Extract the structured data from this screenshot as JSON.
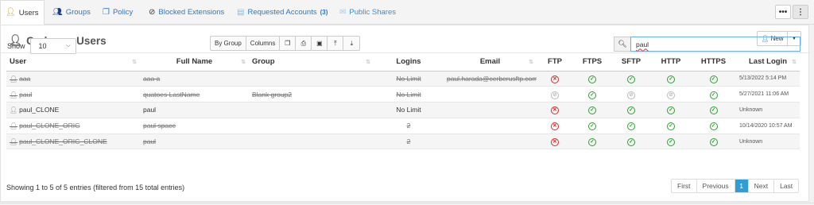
{
  "tabs": [
    {
      "label": "Users",
      "icon": "user-icon"
    },
    {
      "label": "Groups",
      "icon": "group-icon"
    },
    {
      "label": "Policy",
      "icon": "policy-icon"
    },
    {
      "label": "Blocked Extensions",
      "icon": "ban-icon"
    },
    {
      "label": "Requested  Accounts",
      "count": "(3)",
      "icon": "inbox-icon"
    },
    {
      "label": "Public Shares",
      "icon": "envelope-icon"
    }
  ],
  "topbar": {
    "more_label": "•••",
    "menu_label": "⋮"
  },
  "panel": {
    "title": "Cerberus Users",
    "new_label": "New"
  },
  "controls": {
    "show_label": "Show",
    "page_size": "10",
    "buttons": [
      "By Group",
      "Columns"
    ],
    "search_value": "paul"
  },
  "table": {
    "columns": [
      "User",
      "Full Name",
      "Group",
      "Logins",
      "Email",
      "FTP",
      "FTPS",
      "SFTP",
      "HTTP",
      "HTTPS",
      "Last Login"
    ],
    "rows": [
      {
        "user": "aaa",
        "fullname": "aaa a",
        "group": "",
        "logins": "No Limit",
        "email": "paul.harada@cerberusftp.com",
        "ftp": "no",
        "ftps": "ok",
        "sftp": "ok",
        "http": "ok",
        "https": "ok",
        "last_login": "5/13/2022 5:14 PM",
        "deleted": true
      },
      {
        "user": "paul",
        "fullname": "quatoes LastName",
        "group": "Blank group2",
        "logins": "No Limit",
        "email": "",
        "ftp": "off",
        "ftps": "ok",
        "sftp": "off",
        "http": "off",
        "https": "ok",
        "last_login": "5/27/2021 11:06 AM",
        "deleted": true
      },
      {
        "user": "paul_CLONE",
        "fullname": "paul",
        "group": "",
        "logins": "No Limit",
        "email": "",
        "ftp": "no",
        "ftps": "ok",
        "sftp": "ok",
        "http": "ok",
        "https": "ok",
        "last_login": "Unknown",
        "deleted": false
      },
      {
        "user": "paul_CLONE_ORIG",
        "fullname": "paul space",
        "group": "",
        "logins": "2",
        "email": "",
        "ftp": "no",
        "ftps": "ok",
        "sftp": "ok",
        "http": "ok",
        "https": "ok",
        "last_login": "10/14/2020 10:57 AM",
        "deleted": true
      },
      {
        "user": "paul_CLONE_ORIG_CLONE",
        "fullname": "paul",
        "group": "",
        "logins": "2",
        "email": "",
        "ftp": "no",
        "ftps": "ok",
        "sftp": "ok",
        "http": "ok",
        "https": "ok",
        "last_login": "Unknown",
        "deleted": true
      }
    ]
  },
  "footer": {
    "info": "Showing 1 to 5 of 5 entries (filtered from 15 total entries)",
    "pager": [
      "First",
      "Previous",
      "1",
      "Next",
      "Last"
    ]
  },
  "colors": {
    "link": "#2a78c2",
    "ok": "#2ca02c",
    "error": "#c9302c",
    "active_page": "#2e9fd6"
  }
}
